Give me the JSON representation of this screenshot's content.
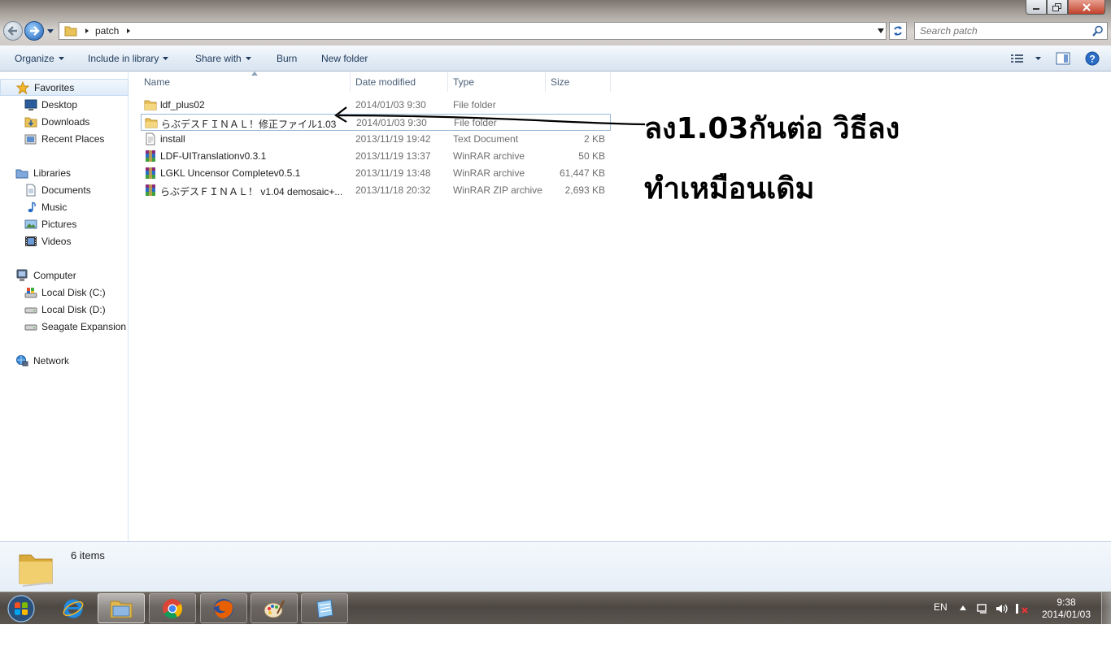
{
  "address": {
    "path": [
      "patch"
    ]
  },
  "search": {
    "placeholder": "Search patch"
  },
  "toolbar": {
    "organize": "Organize",
    "include_in_library": "Include in library",
    "share_with": "Share with",
    "burn": "Burn",
    "new_folder": "New folder"
  },
  "nav": {
    "favorites": "Favorites",
    "desktop": "Desktop",
    "downloads": "Downloads",
    "recent_places": "Recent Places",
    "libraries": "Libraries",
    "documents": "Documents",
    "music": "Music",
    "pictures": "Pictures",
    "videos": "Videos",
    "computer": "Computer",
    "local_c": "Local Disk (C:)",
    "local_d": "Local Disk (D:)",
    "seagate": "Seagate Expansion D",
    "network": "Network"
  },
  "columns": {
    "name": "Name",
    "date": "Date modified",
    "type": "Type",
    "size": "Size"
  },
  "files": [
    {
      "name": "ldf_plus02",
      "date": "2014/01/03 9:30",
      "type": "File folder",
      "size": "",
      "icon": "folder-icon"
    },
    {
      "name": "らぶデスＦＩＮＡＬ！修正ファイル1.03",
      "date": "2014/01/03 9:30",
      "type": "File folder",
      "size": "",
      "icon": "folder-icon"
    },
    {
      "name": "install",
      "date": "2013/11/19 19:42",
      "type": "Text Document",
      "size": "2 KB",
      "icon": "text-file-icon"
    },
    {
      "name": "LDF-UITranslationv0.3.1",
      "date": "2013/11/19 13:37",
      "type": "WinRAR archive",
      "size": "50 KB",
      "icon": "winrar-icon"
    },
    {
      "name": "LGKL Uncensor Completev0.5.1",
      "date": "2013/11/19 13:48",
      "type": "WinRAR archive",
      "size": "61,447 KB",
      "icon": "winrar-icon"
    },
    {
      "name": "らぶデスＦＩＮＡＬ！ v1.04 demosaic+...",
      "date": "2013/11/18 20:32",
      "type": "WinRAR ZIP archive",
      "size": "2,693 KB",
      "icon": "winrar-icon"
    }
  ],
  "annotation": {
    "line1": "ลง1.03กันต่อ วิธีลง",
    "line2": "ทำเหมือนเดิม"
  },
  "details": {
    "count": "6 items"
  },
  "taskbar": {
    "pinned": [
      "ie-icon",
      "explorer-icon",
      "chrome-icon",
      "firefox-icon",
      "paint-icon",
      "notepad-icon"
    ],
    "lang": "EN",
    "time": "9:38",
    "date": "2014/01/03"
  }
}
